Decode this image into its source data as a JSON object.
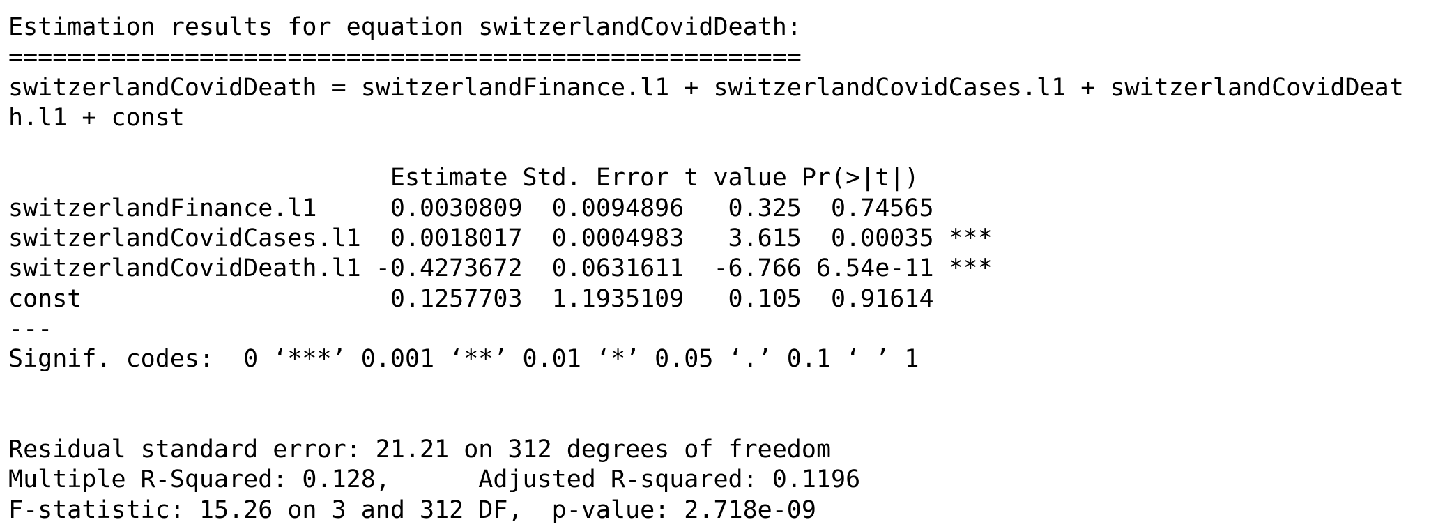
{
  "console": {
    "lines": [
      "Estimation results for equation switzerlandCovidDeath:",
      "======================================================",
      "switzerlandCovidDeath = switzerlandFinance.l1 + switzerlandCovidCases.l1 + switzerlandCovidDeat",
      "h.l1 + const",
      "",
      "                          Estimate Std. Error t value Pr(>|t|)    ",
      "switzerlandFinance.l1     0.0030809  0.0094896   0.325  0.74565    ",
      "switzerlandCovidCases.l1  0.0018017  0.0004983   3.615  0.00035 ***",
      "switzerlandCovidDeath.l1 -0.4273672  0.0631611  -6.766 6.54e-11 ***",
      "const                     0.1257703  1.1935109   0.105  0.91614    ",
      "---",
      "Signif. codes:  0 ‘***’ 0.001 ‘**’ 0.01 ‘*’ 0.05 ‘.’ 0.1 ‘ ’ 1",
      "",
      "",
      "Residual standard error: 21.21 on 312 degrees of freedom",
      "Multiple R-Squared: 0.128,\tAdjusted R-squared: 0.1196 ",
      "F-statistic: 15.26 on 3 and 312 DF,  p-value: 2.718e-09"
    ]
  }
}
